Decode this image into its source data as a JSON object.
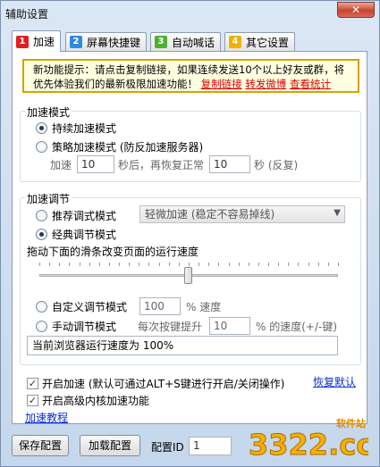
{
  "window": {
    "title": "辅助设置",
    "close_label": "✕"
  },
  "tabs": [
    {
      "num": "1",
      "label": "加速",
      "color": "#e02020",
      "active": true
    },
    {
      "num": "2",
      "label": "屏幕快捷键",
      "color": "#2f8be0",
      "active": false
    },
    {
      "num": "3",
      "label": "自动喊话",
      "color": "#4cb030",
      "active": false
    },
    {
      "num": "4",
      "label": "其它设置",
      "color": "#f0b000",
      "active": false
    }
  ],
  "notice": {
    "line1": "新功能提示：请点击复制链接，如果连续发送10个以上好友或群，将",
    "line2": "优先体验我们的最新极限加速功能！",
    "link_copy": "复制链接",
    "link_weibo": "转发微博",
    "link_stats": "查看统计"
  },
  "mode_group": {
    "title": "加速模式",
    "continuous": "持续加速模式",
    "strategy": "策略加速模式 (防反加速服务器)",
    "accel_prefix": "加速",
    "accel_value": "10",
    "accel_mid": "秒后，再恢复正常",
    "restore_value": "10",
    "restore_suffix": "秒 (反复)"
  },
  "adjust_group": {
    "title": "加速调节",
    "recommend": "推荐调式模式",
    "recommend_select": "轻微加速 (稳定不容易掉线)",
    "classic": "经典调节模式",
    "slider_hint": "拖动下面的滑条改变页面的运行速度",
    "slider_fraction": 0.5,
    "custom": "自定义调节模式",
    "custom_value": "100",
    "custom_suffix": "% 速度",
    "manual": "手动调节模式",
    "manual_prefix": "每次按键提升",
    "manual_value": "10",
    "manual_suffix": "% 的速度(+/-键)",
    "status": "当前浏览器运行速度为 100%"
  },
  "options": {
    "enable_accel": "开启加速 (默认可通过ALT+S键进行开启/关闭操作)",
    "restore_default": "恢复默认",
    "enable_kernel": "开启高级内核加速功能",
    "tutorial": "加速教程"
  },
  "footer": {
    "save": "保存配置",
    "load": "加载配置",
    "config_id_label": "配置ID",
    "config_id_value": "1",
    "watermark_text": "3322.cc",
    "watermark_sub": "软件站"
  }
}
